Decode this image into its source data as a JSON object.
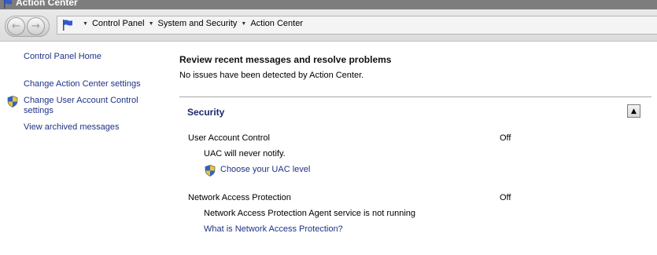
{
  "window": {
    "title": "Action Center",
    "title_icon": "flag-icon",
    "titlebar_color": "#7d7d7d"
  },
  "nav": {
    "back_icon": "back-arrow-icon",
    "forward_icon": "forward-arrow-icon",
    "address_icon": "flag-icon",
    "breadcrumbs": [
      "Control Panel",
      "System and Security",
      "Action Center"
    ]
  },
  "sidebar": {
    "items": [
      {
        "label": "Control Panel Home"
      },
      {
        "label": "Change Action Center settings"
      },
      {
        "label": "Change User Account Control settings",
        "icon": "uac-shield-icon"
      },
      {
        "label": "View archived messages"
      }
    ]
  },
  "main": {
    "heading": "Review recent messages and resolve problems",
    "status_text": "No issues have been detected by Action Center.",
    "security": {
      "title": "Security",
      "collapse_icon": "collapse-up-icon",
      "items": [
        {
          "label": "User Account Control",
          "status": "Off",
          "description": "UAC will never notify.",
          "link": "Choose your UAC level",
          "link_icon": "uac-shield-icon"
        },
        {
          "label": "Network Access Protection",
          "status": "Off",
          "description": "Network Access Protection Agent service is not running",
          "link": "What is Network Access Protection?"
        }
      ]
    }
  },
  "colors": {
    "link": "#1e3287",
    "section_title": "#1a2a6b",
    "divider": "#a7a7a7"
  }
}
